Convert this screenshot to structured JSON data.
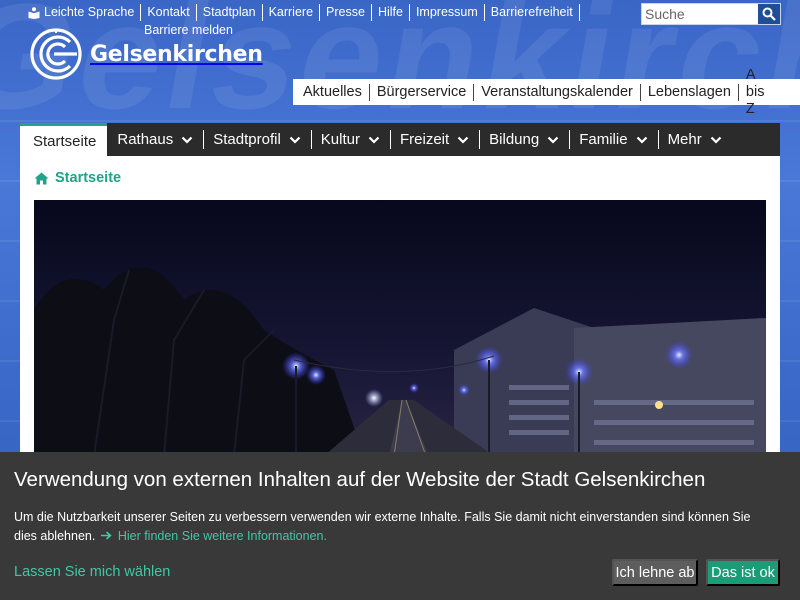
{
  "background_watermark": "Gelsenkirchen",
  "top_links": {
    "items": [
      "Leichte Sprache",
      "Kontakt",
      "Stadtplan",
      "Karriere",
      "Presse",
      "Hilfe",
      "Impressum",
      "Barrierefreiheit"
    ],
    "second_row": "Barriere melden"
  },
  "search": {
    "placeholder": "Suche",
    "value": ""
  },
  "logo": {
    "text": "Gelsenkirchen"
  },
  "quick_links": [
    "Aktuelles",
    "Bürgerservice",
    "Veranstaltungskalender",
    "Lebenslagen",
    "A bis Z"
  ],
  "nav": {
    "active": "Startseite",
    "items": [
      "Rathaus",
      "Stadtprofil",
      "Kultur",
      "Freizeit",
      "Bildung",
      "Familie",
      "Mehr"
    ]
  },
  "breadcrumb": {
    "label": "Startseite"
  },
  "cookie": {
    "title": "Verwendung von externen Inhalten auf der Website der Stadt Gelsenkirchen",
    "text": "Um die Nutzbarkeit unserer Seiten zu verbessern verwenden wir externe Inhalte. Falls Sie damit nicht einverstanden sind können Sie dies ablehnen.",
    "more_link": "Hier finden Sie weitere Informationen.",
    "choose_link": "Lassen Sie mich wählen",
    "decline": "Ich lehne ab",
    "accept": "Das ist ok"
  },
  "colors": {
    "accent_green": "#1fa38a",
    "nav_bg": "#2b2b2b",
    "cookie_bg": "#393939",
    "accept_bg": "#1a9c77",
    "decline_bg": "#5d5d5d",
    "search_button": "#1f4e96"
  },
  "icons": {
    "leichte_sprache": "book-reader-icon",
    "search": "magnifier-icon",
    "breadcrumb": "home-icon",
    "nav_dropdown": "chevron-down-icon",
    "more_link": "arrow-right-icon"
  }
}
